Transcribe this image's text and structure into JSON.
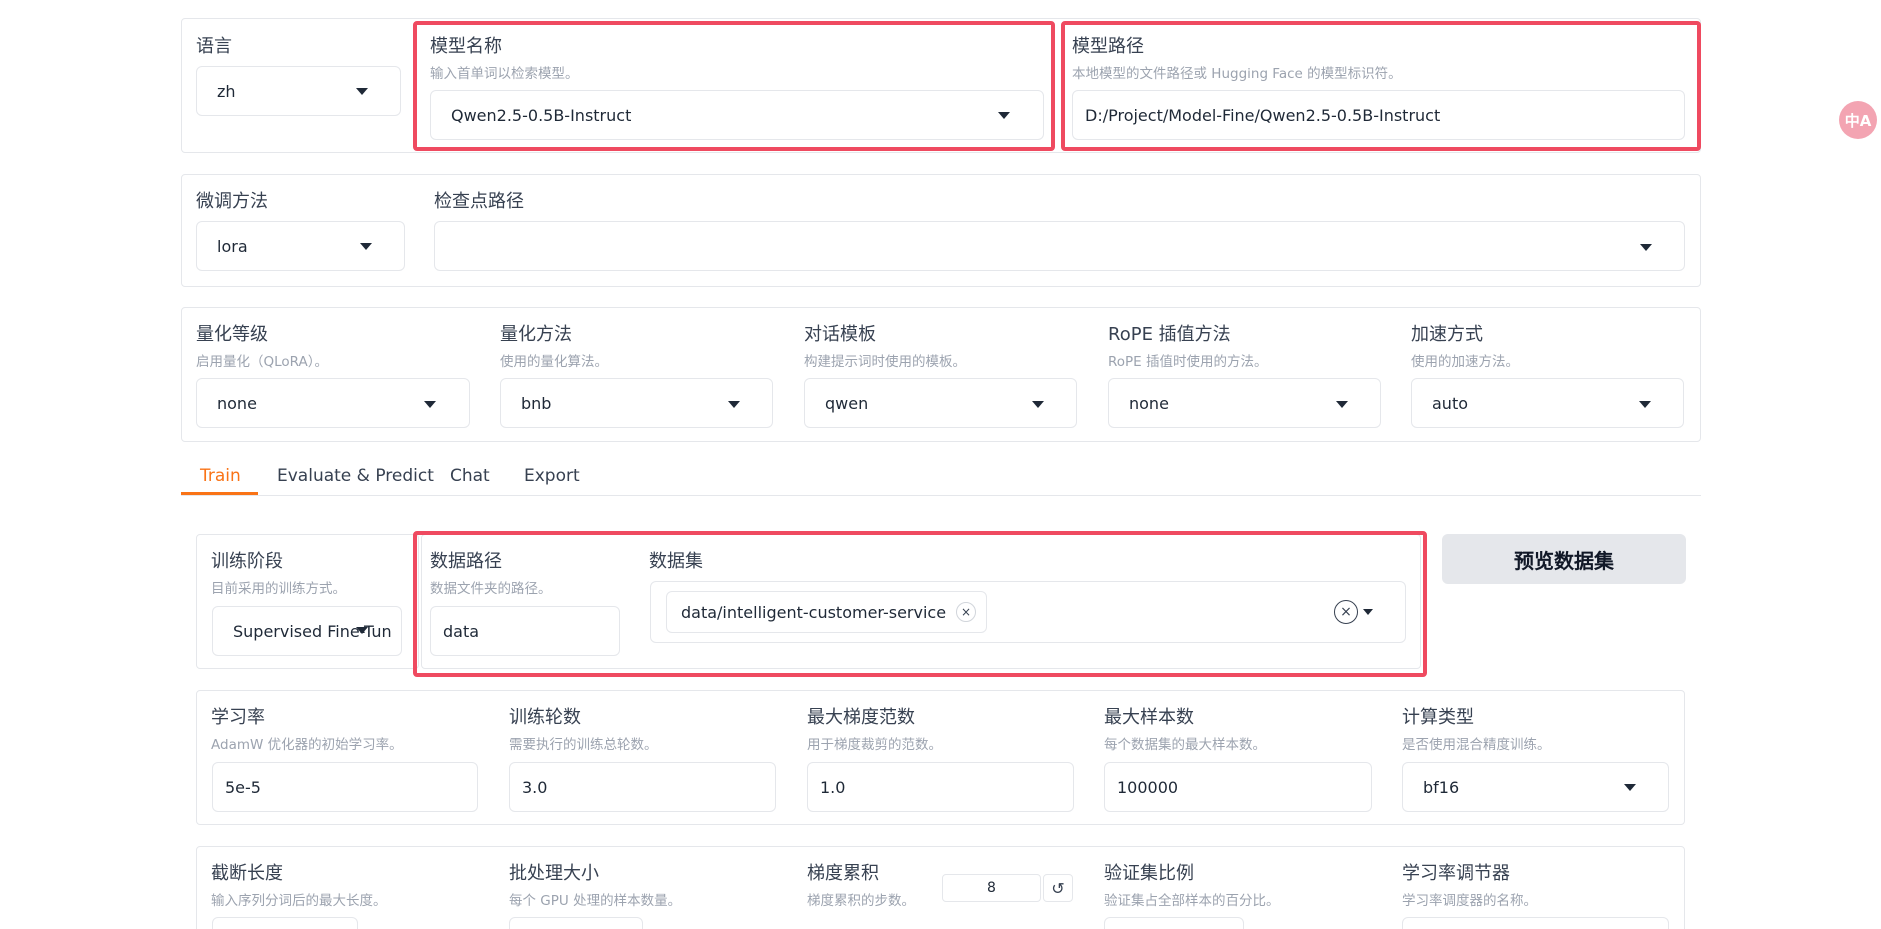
{
  "top_config": {
    "language": {
      "label": "语言",
      "value": "zh"
    },
    "model_name": {
      "label": "模型名称",
      "hint": "输入首单词以检索模型。",
      "value": "Qwen2.5-0.5B-Instruct"
    },
    "model_path": {
      "label": "模型路径",
      "hint": "本地模型的文件路径或 Hugging Face 的模型标识符。",
      "value": "D:/Project/Model-Fine/Qwen2.5-0.5B-Instruct"
    }
  },
  "finetune": {
    "method": {
      "label": "微调方法",
      "value": "lora"
    },
    "checkpoint": {
      "label": "检查点路径",
      "value": ""
    }
  },
  "advanced": {
    "quant_bit": {
      "label": "量化等级",
      "hint": "启用量化（QLoRA）。",
      "value": "none"
    },
    "quant_method": {
      "label": "量化方法",
      "hint": "使用的量化算法。",
      "value": "bnb"
    },
    "template": {
      "label": "对话模板",
      "hint": "构建提示词时使用的模板。",
      "value": "qwen"
    },
    "rope": {
      "label": "RoPE 插值方法",
      "hint": "RoPE 插值时使用的方法。",
      "value": "none"
    },
    "booster": {
      "label": "加速方式",
      "hint": "使用的加速方法。",
      "value": "auto"
    }
  },
  "tabs": [
    "Train",
    "Evaluate & Predict",
    "Chat",
    "Export"
  ],
  "train": {
    "stage": {
      "label": "训练阶段",
      "hint": "目前采用的训练方式。",
      "value": "Supervised Fine-Tun"
    },
    "dataset_dir": {
      "label": "数据路径",
      "hint": "数据文件夹的路径。",
      "value": "data"
    },
    "dataset": {
      "label": "数据集",
      "selected": [
        "data/intelligent-customer-service"
      ]
    },
    "preview_button": "预览数据集"
  },
  "hyper": {
    "learning_rate": {
      "label": "学习率",
      "hint": "AdamW 优化器的初始学习率。",
      "value": "5e-5"
    },
    "epochs": {
      "label": "训练轮数",
      "hint": "需要执行的训练总轮数。",
      "value": "3.0"
    },
    "max_grad_norm": {
      "label": "最大梯度范数",
      "hint": "用于梯度裁剪的范数。",
      "value": "1.0"
    },
    "max_samples": {
      "label": "最大样本数",
      "hint": "每个数据集的最大样本数。",
      "value": "100000"
    },
    "compute_type": {
      "label": "计算类型",
      "hint": "是否使用混合精度训练。",
      "value": "bf16"
    }
  },
  "hyper2": {
    "cutoff_len": {
      "label": "截断长度",
      "hint": "输入序列分词后的最大长度。"
    },
    "batch_size": {
      "label": "批处理大小",
      "hint": "每个 GPU 处理的样本数量。"
    },
    "grad_accum": {
      "label": "梯度累积",
      "hint": "梯度累积的步数。",
      "value": "8"
    },
    "val_size": {
      "label": "验证集比例",
      "hint": "验证集占全部样本的百分比。"
    },
    "lr_scheduler": {
      "label": "学习率调节器",
      "hint": "学习率调度器的名称。"
    }
  },
  "icons": {
    "dropdown": "chevron-down-icon",
    "clear": "clear-icon",
    "remove": "remove-chip-icon",
    "reset": "reset-icon",
    "translate": "translate-icon"
  },
  "accent": "#f97316",
  "highlight_color": "#ef4a60",
  "badge_text": "中A",
  "icon_glyphs": {
    "x": "×",
    "reset": "↺"
  }
}
